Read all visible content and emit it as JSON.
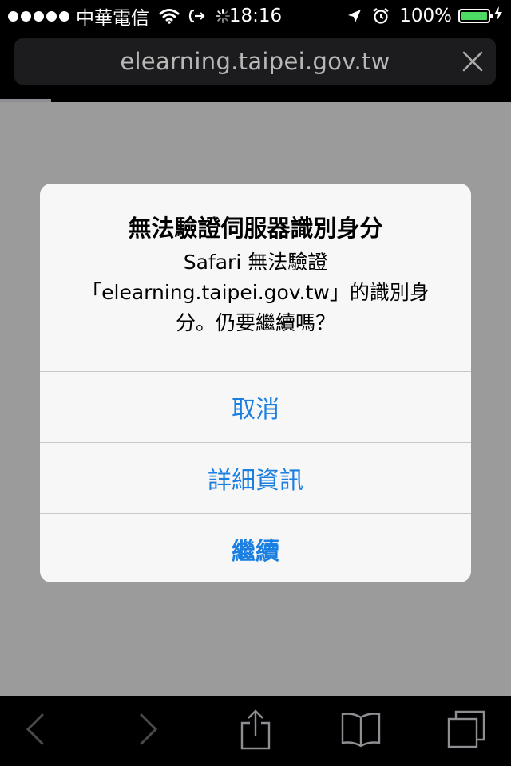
{
  "status_bar": {
    "carrier": "中華電信",
    "time": "18:16",
    "battery_percent": "100%",
    "battery_level": 1.0,
    "icons": [
      "signal-dots",
      "wifi-icon",
      "sync-icon",
      "activity-spinner-icon",
      "location-icon",
      "alarm-icon",
      "battery-icon",
      "charging-icon"
    ]
  },
  "address_bar": {
    "url": "elearning.taipei.gov.tw",
    "close_icon": "close-icon",
    "load_progress": 0.1
  },
  "alert": {
    "title": "無法驗證伺服器識別身分",
    "message_line1": "Safari 無法驗證",
    "message_line2": "「elearning.taipei.gov.tw」的識別身",
    "message_line3": "分。仍要繼續嗎？",
    "buttons": {
      "cancel": "取消",
      "details": "詳細資訊",
      "continue": "繼續"
    },
    "accent_color": "#1a7fe0"
  },
  "toolbar": {
    "icons": [
      "back-icon",
      "forward-icon",
      "share-icon",
      "bookmarks-icon",
      "tabs-icon"
    ]
  },
  "colors": {
    "page_dim": "#9b9b9b",
    "battery_green": "#4cd964"
  }
}
